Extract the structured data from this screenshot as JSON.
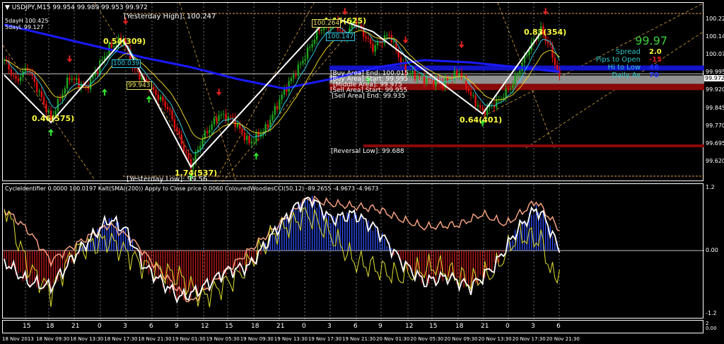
{
  "header": {
    "symbol_line": "USDJPY,M15  99.954 99.989 99.953 99.972",
    "five_day_high": "5dayH 100.425",
    "five_day_low": "5dayL 99.127"
  },
  "levels": {
    "yesterday_high": "[Yesterday High]: 100.247",
    "yesterday_low": "[Yesterday Low]: 99.56",
    "buy_end": "[Buy Area] End: 100.015",
    "buy_start": "[Buy Area] Start: 99.995",
    "middle": "[Middle Area]: 99.975",
    "sell_start": "[Sell Area] Start: 99.955",
    "sell_end": "[Sell Area] End: 99.935",
    "reversal_low": "[Reversal Low]: 99.688"
  },
  "zigzag_labels": [
    "0.46(575)",
    "0.54(309)",
    "1.74(537)",
    "1.15(625)",
    "0.64(401)",
    "0.83(354)"
  ],
  "price_boxes": [
    "100.039",
    "99.943",
    "100.264",
    "100.147"
  ],
  "info_panel": {
    "price": "99.97",
    "spread_label": "Spread",
    "spread": "2.0",
    "pips_label": "Pips to Open",
    "pips": "-15",
    "hilo_label": "Hi to Low",
    "hilo": "46",
    "daily_label": "Daily Av",
    "daily": "70"
  },
  "price_axis": {
    "ticks": [
      "100.220",
      "100.145",
      "100.070",
      "99.995",
      "99.920",
      "99.845",
      "99.770",
      "99.695",
      "99.620"
    ],
    "current": "99.972"
  },
  "indicator": {
    "header": "CycleIdentifier 0.0000 100.0197  Kalt(SMA((200)) Apply to Close price 0.0060  ColouredWoodiesCCI(50,12) -89.2655 -4.9673 -4.9673",
    "ticks": [
      "1.2",
      "0.00",
      "-1.2"
    ],
    "extra_ticks": [
      "2",
      "0.00"
    ]
  },
  "time_axis": {
    "hours": [
      "15",
      "18",
      "21",
      "0",
      "3",
      "6",
      "9",
      "12",
      "15",
      "18",
      "21",
      "0",
      "3",
      "6",
      "9",
      "12",
      "15",
      "18",
      "21",
      "0",
      "3",
      "6"
    ],
    "dates": [
      "18 Nov 2013",
      "18 Nov 09:30",
      "18 Nov 13:30",
      "18 Nov 17:30",
      "18 Nov 21:30",
      "19 Nov 01:30",
      "19 Nov 05:30",
      "19 Nov 09:30",
      "19 Nov 13:30",
      "19 Nov 17:30",
      "19 Nov 21:30",
      "20 Nov 01:30",
      "20 Nov 05:30",
      "20 Nov 09:30",
      "20 Nov 13:30",
      "20 Nov 17:30",
      "20 Nov 21:30"
    ]
  },
  "colors": {
    "up": "#1fa31f",
    "down": "#e01010",
    "ma": "#1a1aff",
    "fast": "#30c8e0",
    "slow": "#e8d020",
    "zigzag": "#ffffff",
    "hist_pos": "#3050ff",
    "hist_neg": "#c01818",
    "osc_white": "#ffffff",
    "osc_salmon": "#f4a080",
    "osc_yellow": "#e0e030"
  },
  "chart_data": {
    "type": "candlestick",
    "ylim": [
      99.545,
      100.29
    ],
    "price_waypoints": [
      [
        0,
        100.05
      ],
      [
        5,
        99.96
      ],
      [
        10,
        100.02
      ],
      [
        20,
        99.8
      ],
      [
        28,
        99.98
      ],
      [
        35,
        99.93
      ],
      [
        45,
        100.1
      ],
      [
        51,
        100.14
      ],
      [
        55,
        100.02
      ],
      [
        62,
        99.94
      ],
      [
        70,
        99.85
      ],
      [
        80,
        99.6
      ],
      [
        85,
        99.72
      ],
      [
        92,
        99.82
      ],
      [
        98,
        99.8
      ],
      [
        105,
        99.7
      ],
      [
        112,
        99.76
      ],
      [
        120,
        99.92
      ],
      [
        128,
        100.05
      ],
      [
        135,
        100.18
      ],
      [
        142,
        100.21
      ],
      [
        146,
        100.14
      ],
      [
        150,
        100.22
      ],
      [
        158,
        100.1
      ],
      [
        165,
        100.16
      ],
      [
        172,
        100.0
      ],
      [
        180,
        99.97
      ],
      [
        188,
        99.95
      ],
      [
        195,
        100.0
      ],
      [
        200,
        99.9
      ],
      [
        205,
        99.83
      ],
      [
        212,
        99.88
      ],
      [
        218,
        99.95
      ],
      [
        225,
        100.1
      ],
      [
        230,
        100.18
      ],
      [
        234,
        100.1
      ],
      [
        238,
        99.972
      ]
    ],
    "ma_waypoints": [
      [
        0,
        100.2
      ],
      [
        30,
        100.13
      ],
      [
        60,
        100.06
      ],
      [
        80,
        100.02
      ],
      [
        100,
        99.97
      ],
      [
        120,
        99.93
      ],
      [
        140,
        99.97
      ],
      [
        160,
        100.02
      ],
      [
        180,
        100.05
      ],
      [
        200,
        100.04
      ],
      [
        220,
        100.02
      ],
      [
        238,
        100.0
      ]
    ],
    "zigzag": [
      [
        0,
        99.987
      ],
      [
        20,
        99.787
      ],
      [
        51,
        100.136
      ],
      [
        80,
        99.599
      ],
      [
        135,
        100.187
      ],
      [
        144,
        100.22
      ],
      [
        158,
        100.17
      ],
      [
        205,
        99.823
      ],
      [
        230,
        100.166
      ]
    ],
    "arrows_up": [
      [
        20,
        99.76
      ],
      [
        43,
        99.93
      ],
      [
        62,
        99.9
      ],
      [
        80,
        99.57
      ],
      [
        108,
        99.66
      ],
      [
        156,
        99.98
      ],
      [
        205,
        99.8
      ]
    ],
    "arrows_down": [
      [
        28,
        100.04
      ],
      [
        52,
        100.2
      ],
      [
        92,
        99.9
      ],
      [
        146,
        100.24
      ],
      [
        172,
        100.12
      ],
      [
        196,
        100.1
      ],
      [
        232,
        100.24
      ]
    ],
    "osc_ylim": [
      -1.2,
      1.2
    ],
    "osc_white": [
      [
        0,
        -0.2
      ],
      [
        10,
        -0.6
      ],
      [
        20,
        -0.7
      ],
      [
        30,
        -0.1
      ],
      [
        45,
        0.6
      ],
      [
        52,
        0.4
      ],
      [
        60,
        -0.3
      ],
      [
        75,
        -0.9
      ],
      [
        82,
        -0.8
      ],
      [
        95,
        -0.4
      ],
      [
        105,
        -0.3
      ],
      [
        115,
        0.3
      ],
      [
        125,
        0.85
      ],
      [
        132,
        1.0
      ],
      [
        140,
        0.6
      ],
      [
        150,
        0.7
      ],
      [
        160,
        0.4
      ],
      [
        170,
        -0.2
      ],
      [
        180,
        -0.6
      ],
      [
        190,
        -0.5
      ],
      [
        200,
        -0.7
      ],
      [
        210,
        -0.3
      ],
      [
        220,
        0.4
      ],
      [
        228,
        0.8
      ],
      [
        232,
        0.6
      ],
      [
        238,
        0.0
      ]
    ],
    "osc_salmon": [
      [
        0,
        0.8
      ],
      [
        10,
        0.4
      ],
      [
        20,
        -0.2
      ],
      [
        30,
        0.1
      ],
      [
        45,
        0.5
      ],
      [
        55,
        0.2
      ],
      [
        65,
        -0.3
      ],
      [
        80,
        -1.0
      ],
      [
        90,
        -0.6
      ],
      [
        100,
        -0.2
      ],
      [
        110,
        0.2
      ],
      [
        120,
        0.6
      ],
      [
        130,
        1.0
      ],
      [
        140,
        0.9
      ],
      [
        160,
        0.8
      ],
      [
        170,
        0.6
      ],
      [
        180,
        0.45
      ],
      [
        195,
        0.5
      ],
      [
        205,
        0.7
      ],
      [
        215,
        0.5
      ],
      [
        228,
        0.95
      ],
      [
        238,
        0.4
      ]
    ],
    "osc_yellow": [
      [
        0,
        0.9
      ],
      [
        10,
        -0.3
      ],
      [
        20,
        -0.8
      ],
      [
        30,
        0.0
      ],
      [
        45,
        0.2
      ],
      [
        60,
        -0.3
      ],
      [
        75,
        -0.5
      ],
      [
        85,
        -0.9
      ],
      [
        100,
        -0.5
      ],
      [
        115,
        0.3
      ],
      [
        130,
        0.7
      ],
      [
        140,
        0.3
      ],
      [
        150,
        -0.2
      ],
      [
        170,
        -0.5
      ],
      [
        185,
        -0.3
      ],
      [
        200,
        -0.6
      ],
      [
        210,
        -0.4
      ],
      [
        220,
        0.3
      ],
      [
        230,
        0.2
      ],
      [
        236,
        -0.6
      ],
      [
        238,
        -0.3
      ]
    ]
  }
}
